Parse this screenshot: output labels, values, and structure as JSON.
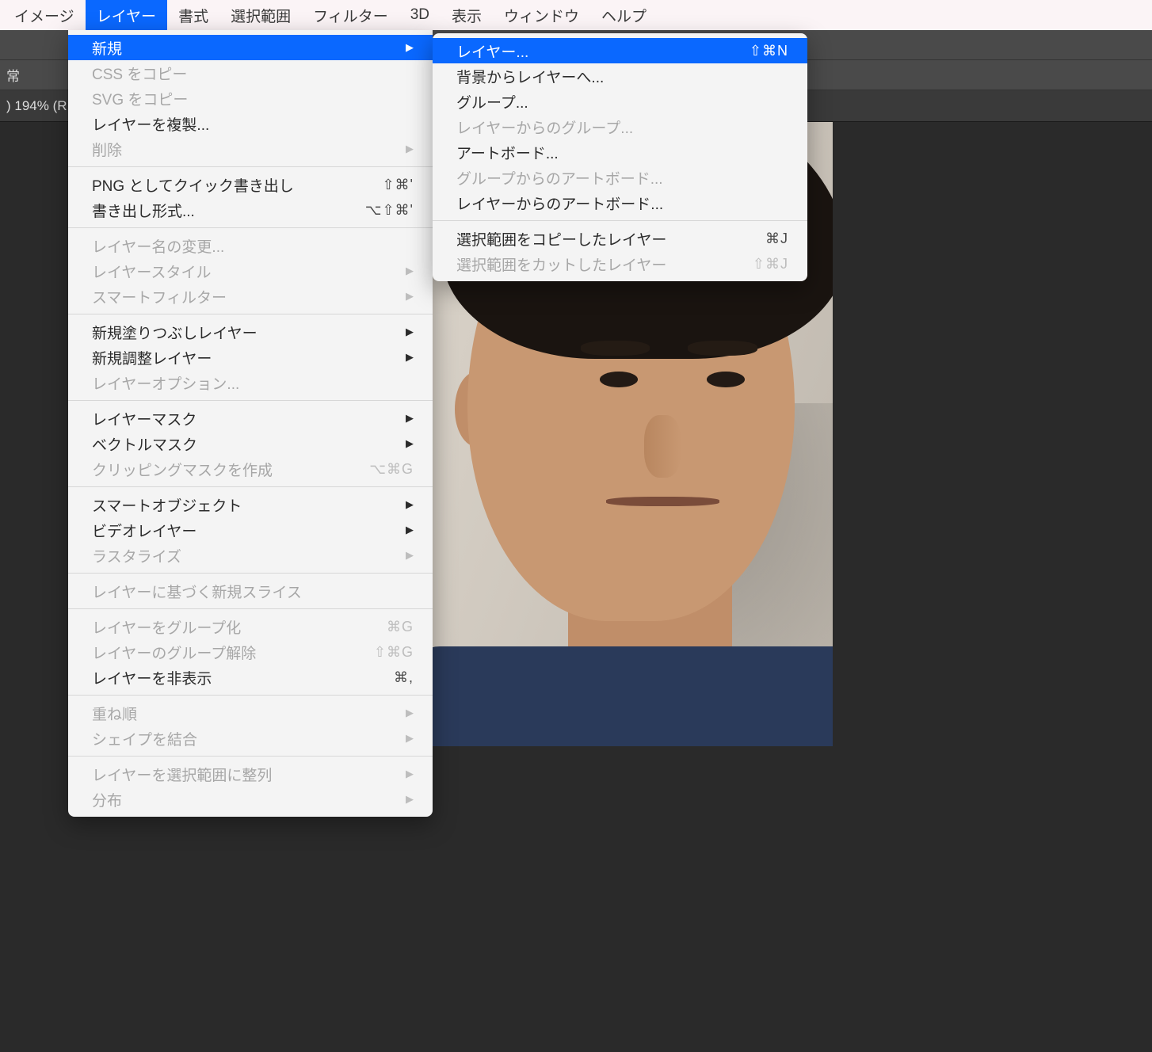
{
  "menubar": {
    "items": [
      {
        "label": "イメージ",
        "highlighted": false
      },
      {
        "label": "レイヤー",
        "highlighted": true
      },
      {
        "label": "書式",
        "highlighted": false
      },
      {
        "label": "選択範囲",
        "highlighted": false
      },
      {
        "label": "フィルター",
        "highlighted": false
      },
      {
        "label": "3D",
        "highlighted": false
      },
      {
        "label": "表示",
        "highlighted": false
      },
      {
        "label": "ウィンドウ",
        "highlighted": false
      },
      {
        "label": "ヘルプ",
        "highlighted": false
      }
    ]
  },
  "chrome": {
    "row1_partial": "",
    "row2_partial": "常",
    "row3_partial": ") 194% (R"
  },
  "dropdown": {
    "groups": [
      [
        {
          "label": "新規",
          "shortcut": "",
          "arrow": true,
          "disabled": false,
          "highlighted": true
        },
        {
          "label": "CSS をコピー",
          "shortcut": "",
          "arrow": false,
          "disabled": true
        },
        {
          "label": "SVG をコピー",
          "shortcut": "",
          "arrow": false,
          "disabled": true
        },
        {
          "label": "レイヤーを複製...",
          "shortcut": "",
          "arrow": false,
          "disabled": false
        },
        {
          "label": "削除",
          "shortcut": "",
          "arrow": true,
          "disabled": true
        }
      ],
      [
        {
          "label": "PNG としてクイック書き出し",
          "shortcut": "⇧⌘'",
          "arrow": false,
          "disabled": false
        },
        {
          "label": "書き出し形式...",
          "shortcut": "⌥⇧⌘'",
          "arrow": false,
          "disabled": false
        }
      ],
      [
        {
          "label": "レイヤー名の変更...",
          "shortcut": "",
          "arrow": false,
          "disabled": true
        },
        {
          "label": "レイヤースタイル",
          "shortcut": "",
          "arrow": true,
          "disabled": true
        },
        {
          "label": "スマートフィルター",
          "shortcut": "",
          "arrow": true,
          "disabled": true
        }
      ],
      [
        {
          "label": "新規塗りつぶしレイヤー",
          "shortcut": "",
          "arrow": true,
          "disabled": false
        },
        {
          "label": "新規調整レイヤー",
          "shortcut": "",
          "arrow": true,
          "disabled": false
        },
        {
          "label": "レイヤーオプション...",
          "shortcut": "",
          "arrow": false,
          "disabled": true
        }
      ],
      [
        {
          "label": "レイヤーマスク",
          "shortcut": "",
          "arrow": true,
          "disabled": false
        },
        {
          "label": "ベクトルマスク",
          "shortcut": "",
          "arrow": true,
          "disabled": false
        },
        {
          "label": "クリッピングマスクを作成",
          "shortcut": "⌥⌘G",
          "arrow": false,
          "disabled": true
        }
      ],
      [
        {
          "label": "スマートオブジェクト",
          "shortcut": "",
          "arrow": true,
          "disabled": false
        },
        {
          "label": "ビデオレイヤー",
          "shortcut": "",
          "arrow": true,
          "disabled": false
        },
        {
          "label": "ラスタライズ",
          "shortcut": "",
          "arrow": true,
          "disabled": true
        }
      ],
      [
        {
          "label": "レイヤーに基づく新規スライス",
          "shortcut": "",
          "arrow": false,
          "disabled": true
        }
      ],
      [
        {
          "label": "レイヤーをグループ化",
          "shortcut": "⌘G",
          "arrow": false,
          "disabled": true
        },
        {
          "label": "レイヤーのグループ解除",
          "shortcut": "⇧⌘G",
          "arrow": false,
          "disabled": true
        },
        {
          "label": "レイヤーを非表示",
          "shortcut": "⌘,",
          "arrow": false,
          "disabled": false
        }
      ],
      [
        {
          "label": "重ね順",
          "shortcut": "",
          "arrow": true,
          "disabled": true
        },
        {
          "label": "シェイプを結合",
          "shortcut": "",
          "arrow": true,
          "disabled": true
        }
      ],
      [
        {
          "label": "レイヤーを選択範囲に整列",
          "shortcut": "",
          "arrow": true,
          "disabled": true
        },
        {
          "label": "分布",
          "shortcut": "",
          "arrow": true,
          "disabled": true
        }
      ]
    ]
  },
  "submenu": {
    "groups": [
      [
        {
          "label": "レイヤー...",
          "shortcut": "⇧⌘N",
          "arrow": false,
          "disabled": false,
          "highlighted": true
        },
        {
          "label": "背景からレイヤーへ...",
          "shortcut": "",
          "arrow": false,
          "disabled": false
        },
        {
          "label": "グループ...",
          "shortcut": "",
          "arrow": false,
          "disabled": false
        },
        {
          "label": "レイヤーからのグループ...",
          "shortcut": "",
          "arrow": false,
          "disabled": true
        },
        {
          "label": "アートボード...",
          "shortcut": "",
          "arrow": false,
          "disabled": false
        },
        {
          "label": "グループからのアートボード...",
          "shortcut": "",
          "arrow": false,
          "disabled": true
        },
        {
          "label": "レイヤーからのアートボード...",
          "shortcut": "",
          "arrow": false,
          "disabled": false
        }
      ],
      [
        {
          "label": "選択範囲をコピーしたレイヤー",
          "shortcut": "⌘J",
          "arrow": false,
          "disabled": false
        },
        {
          "label": "選択範囲をカットしたレイヤー",
          "shortcut": "⇧⌘J",
          "arrow": false,
          "disabled": true
        }
      ]
    ]
  }
}
